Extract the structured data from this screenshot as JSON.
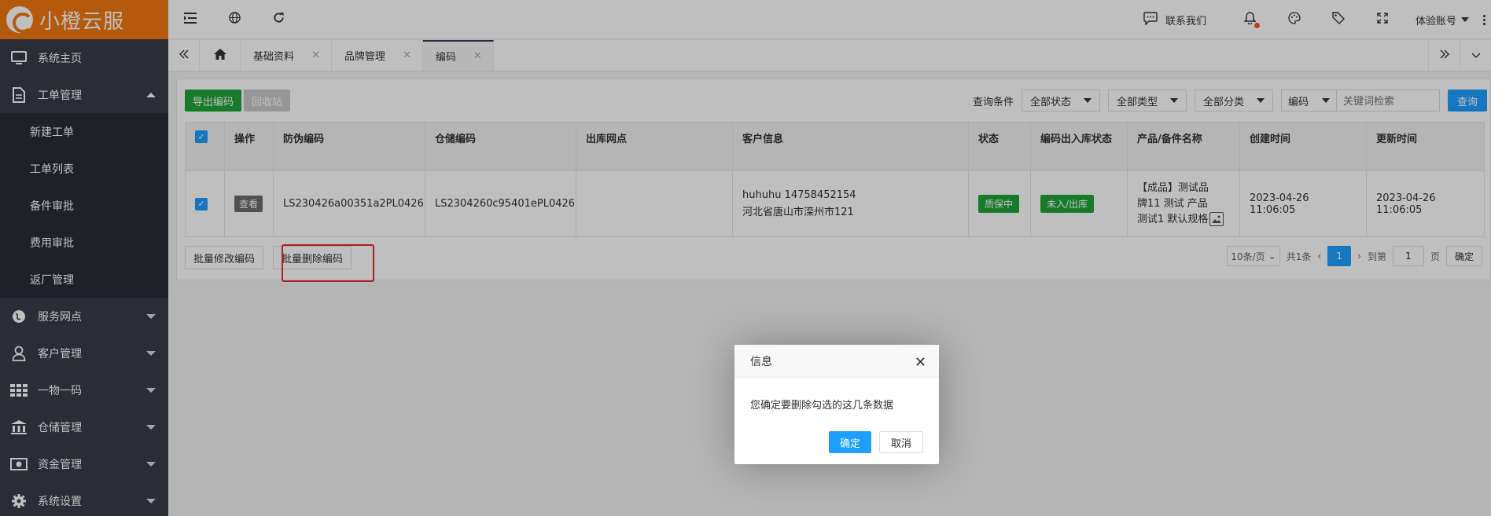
{
  "brand": {
    "name": "小橙云服",
    "color": "#f27712"
  },
  "sidebar": {
    "items": [
      {
        "label": "系统主页",
        "icon": "monitor-icon"
      },
      {
        "label": "工单管理",
        "icon": "document-icon",
        "expanded": true,
        "children": [
          "新建工单",
          "工单列表",
          "备件审批",
          "费用审批",
          "返厂管理"
        ]
      },
      {
        "label": "服务网点",
        "icon": "globe-icon"
      },
      {
        "label": "客户管理",
        "icon": "user-icon"
      },
      {
        "label": "一物一码",
        "icon": "grid-icon"
      },
      {
        "label": "仓储管理",
        "icon": "bank-icon"
      },
      {
        "label": "资金管理",
        "icon": "money-icon"
      },
      {
        "label": "系统设置",
        "icon": "gear-icon"
      }
    ]
  },
  "header": {
    "contact": "联系我们",
    "account": "体验账号"
  },
  "tabs": [
    {
      "label": "基础资料"
    },
    {
      "label": "品牌管理"
    },
    {
      "label": "编码",
      "active": true
    }
  ],
  "toolbar": {
    "export": "导出编码",
    "recycle": "回收站",
    "filter_label": "查询条件",
    "status_select": "全部状态",
    "type_select": "全部类型",
    "category_select": "全部分类",
    "search_field": "编码",
    "search_placeholder": "关键词检索",
    "search_button": "查询"
  },
  "table": {
    "headers": [
      "操作",
      "防伪编码",
      "仓储编码",
      "出库网点",
      "客户信息",
      "状态",
      "编码出入库状态",
      "产品/备件名称",
      "创建时间",
      "更新时间"
    ],
    "rows": [
      {
        "action": "查看",
        "anti_fake_code": "LS230426a00351a2PL0426",
        "storage_code": "LS2304260c95401ePL0426",
        "outlet": "",
        "customer_line1": "huhuhu 14758452154",
        "customer_line2": "河北省唐山市滦州市121",
        "status": "质保中",
        "inout_status": "未入/出库",
        "product": "【成品】测试品牌11 测试 产品测试1 默认规格",
        "created": "2023-04-26 11:06:05",
        "updated": "2023-04-26 11:06:05"
      }
    ]
  },
  "footer": {
    "batch_edit": "批量修改编码",
    "batch_delete": "批量删除编码",
    "page_size": "10条/页",
    "total": "共1条",
    "current_page": "1",
    "goto_label": "到第",
    "goto_value": "1",
    "page_unit": "页",
    "confirm": "确定"
  },
  "dialog": {
    "title": "信息",
    "message": "您确定要删除勾选的这几条数据",
    "ok": "确定",
    "cancel": "取消"
  }
}
